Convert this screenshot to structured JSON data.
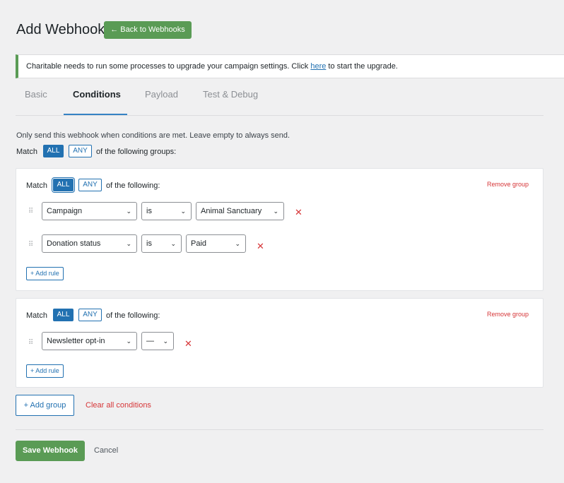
{
  "page": {
    "title": "Add Webhook",
    "back_label": "← Back to Webhooks"
  },
  "notice": {
    "text_before": "Charitable needs to run some processes to upgrade your campaign settings. Click ",
    "link": "here",
    "text_after": " to start the upgrade."
  },
  "tabs": [
    {
      "label": "Basic",
      "active": false
    },
    {
      "label": "Conditions",
      "active": true
    },
    {
      "label": "Payload",
      "active": false
    },
    {
      "label": "Test & Debug",
      "active": false
    }
  ],
  "conditions": {
    "description": "Only send this webhook when conditions are met. Leave empty to always send.",
    "match_label": "Match",
    "all_label": "ALL",
    "any_label": "ANY",
    "groups_suffix": "of the following groups:",
    "top_mode": "ALL"
  },
  "groups": [
    {
      "match_label": "Match",
      "all_label": "ALL",
      "any_label": "ANY",
      "suffix": "of the following:",
      "remove_label": "Remove group",
      "mode": "ALL",
      "rules": [
        {
          "field": "Campaign",
          "operator": "is",
          "value": "Animal Sanctuary"
        },
        {
          "field": "Donation status",
          "operator": "is",
          "value": "Paid"
        }
      ],
      "add_rule_label": "+ Add rule"
    },
    {
      "match_label": "Match",
      "all_label": "ALL",
      "any_label": "ANY",
      "suffix": "of the following:",
      "remove_label": "Remove group",
      "mode": "ALL",
      "rules": [
        {
          "field": "Newsletter opt-in",
          "operator": "—",
          "value": null
        }
      ],
      "add_rule_label": "+ Add rule"
    }
  ],
  "actions": {
    "add_group": "+ Add group",
    "clear_all": "Clear all conditions",
    "save": "Save Webhook",
    "cancel": "Cancel"
  },
  "icons": {
    "drag": "drag-handle-icon",
    "chevron": "chevron-down-icon",
    "remove": "close-icon"
  },
  "colors": {
    "brand_green": "#5a9b55",
    "accent_blue": "#2271b1",
    "danger_red": "#d63638"
  }
}
